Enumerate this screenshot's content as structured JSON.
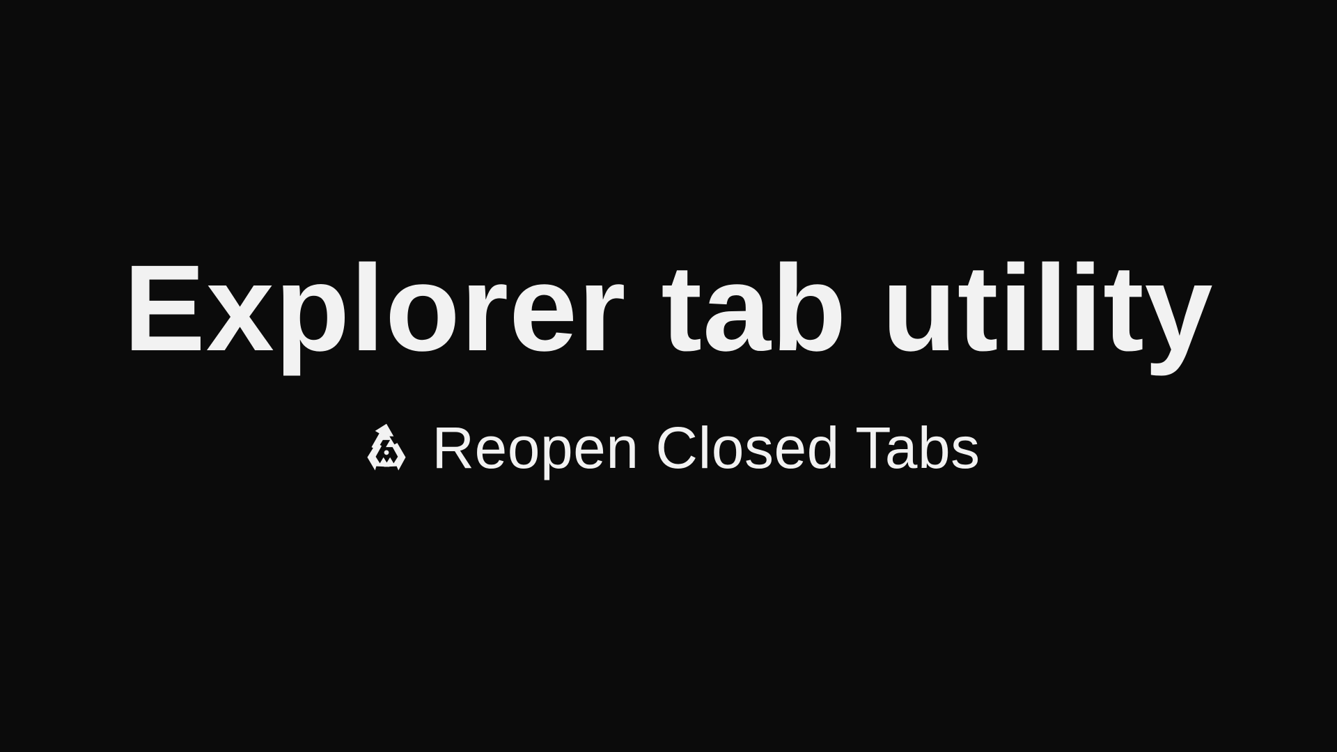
{
  "screen": {
    "title": "Explorer tab utility",
    "subtitle": "Reopen Closed Tabs",
    "subtitle_icon": "recycle-icon"
  },
  "theme": {
    "background": "#0b0b0b",
    "text": "#f2f2f2"
  }
}
